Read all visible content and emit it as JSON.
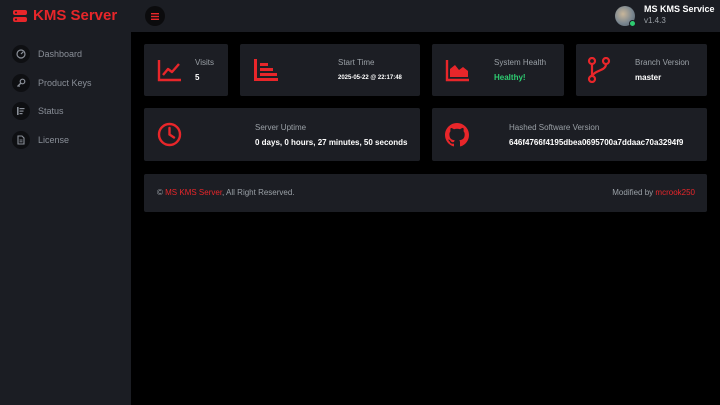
{
  "header": {
    "brand": "KMS Server",
    "service_name": "MS KMS Service",
    "version": "v1.4.3"
  },
  "sidebar": {
    "items": [
      {
        "label": "Dashboard",
        "icon": "dashboard-icon"
      },
      {
        "label": "Product Keys",
        "icon": "key-icon"
      },
      {
        "label": "Status",
        "icon": "list-icon"
      },
      {
        "label": "License",
        "icon": "document-icon"
      }
    ]
  },
  "cards": {
    "visits": {
      "label": "Visits",
      "value": "5",
      "icon": "line-chart-icon"
    },
    "start_time": {
      "label": "Start Time",
      "value": "2025-05-22 @ 22:17:48",
      "icon": "bar-chart-icon"
    },
    "system_health": {
      "label": "System Health",
      "value": "Healthy!",
      "icon": "area-chart-icon"
    },
    "branch_version": {
      "label": "Branch Version",
      "value": "master",
      "icon": "git-branch-icon"
    },
    "server_uptime": {
      "label": "Server Uptime",
      "value": "0 days, 0 hours, 27 minutes, 50 seconds",
      "icon": "clock-icon"
    },
    "hashed_version": {
      "label": "Hashed Software Version",
      "value": "646f4766f4195dbea0695700a7ddaac70a3294f9",
      "icon": "github-icon"
    }
  },
  "footer": {
    "copyright_symbol": "©",
    "link_text": "MS KMS Server",
    "rights_text": ", All Right Reserved.",
    "modified_prefix": "Modified by",
    "author": "mcrook250"
  },
  "colors": {
    "accent": "#e8262a",
    "healthy": "#2ecc71",
    "panel": "#1c1e24",
    "background": "#000000"
  }
}
